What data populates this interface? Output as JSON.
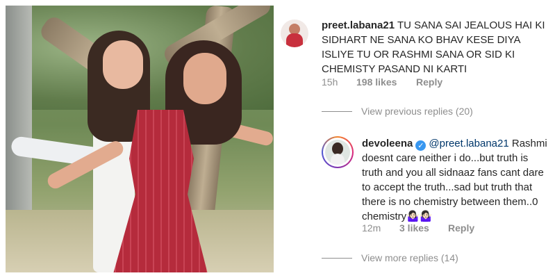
{
  "comment1": {
    "username": "preet.labana21",
    "text": "TU SANA SAI JEALOUS HAI KI SIDHART NE SANA KO BHAV KESE DIYA ISLIYE TU OR RASHMI SANA OR SID KI CHEMISTY PASAND NI KARTI",
    "time": "15h",
    "likes": "198 likes",
    "reply_label": "Reply"
  },
  "view_previous_replies": "View previous replies (20)",
  "reply1": {
    "username": "devoleena",
    "mention": "@preet.labana21",
    "verified_glyph": "✓",
    "text": "Rashmi doesnt care neither i do...but truth is truth and you all sidnaaz fans cant dare to accept the truth...sad but truth that there is no chemistry between them..0 chemistry🤷🏻‍♀️🤷🏻‍♀️",
    "time": "12m",
    "likes": "3 likes",
    "reply_label": "Reply"
  },
  "view_more_replies": "View more replies (14)",
  "colors": {
    "text": "#262626",
    "meta": "#8e8e8e",
    "mention": "#00376b",
    "verified": "#3897f0"
  },
  "icons": {
    "verified": "verified-badge-icon"
  }
}
